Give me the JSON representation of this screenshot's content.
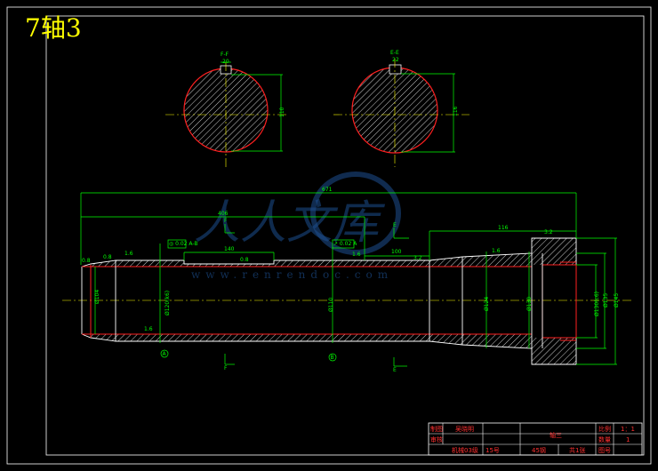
{
  "drawing": {
    "title": "7轴3",
    "sections": [
      {
        "label": "F-F",
        "dim_top": "20",
        "dim_side": "110"
      },
      {
        "label": "E-E",
        "dim_top": "22",
        "dim_side": "116"
      }
    ],
    "dimensions": {
      "overall_length": "671",
      "left_length": "406",
      "seg_140": "140",
      "seg_116": "116",
      "seg_100": "100",
      "dia_left": "Ø104",
      "dia_bearing": "Ø120(k6)",
      "dia_mid": "Ø110",
      "dia_right_a": "Ø124",
      "dia_right_b": "Ø130",
      "dia_end_a": "Ø130(c6)",
      "dia_end_b": "Ø135",
      "dia_end_c": "Ø145"
    },
    "markers": {
      "datum_a": "A",
      "datum_b": "B",
      "section_f": "F",
      "section_e": "E"
    },
    "roughness": [
      "0.8",
      "0.8",
      "1.6",
      "1.6",
      "0.8",
      "1.6",
      "3.2",
      "1.6",
      "3.2",
      "1.6",
      "1.6"
    ],
    "tolerance_frames": [
      "◎ 0.02 A-B",
      "↗ 0.02 A"
    ]
  },
  "watermark": {
    "text": "人人文库",
    "url": "www.renrendoc.com"
  },
  "title_block": {
    "row1": [
      "制图",
      "吴晓明",
      "",
      "轴三",
      "比例",
      "1：1"
    ],
    "row2": [
      "审核",
      "",
      "",
      "",
      "数量",
      "1"
    ],
    "row3": [
      "机械03级",
      "15号",
      "",
      "",
      "第1张",
      "图号"
    ],
    "material": "45钢",
    "sheet": "共1张"
  },
  "colors": {
    "outline": "#ffffff",
    "dimension": "#00ff00",
    "centerline": "#ffff00",
    "hatch_edge": "#ff2020",
    "title": "#ffff00"
  }
}
